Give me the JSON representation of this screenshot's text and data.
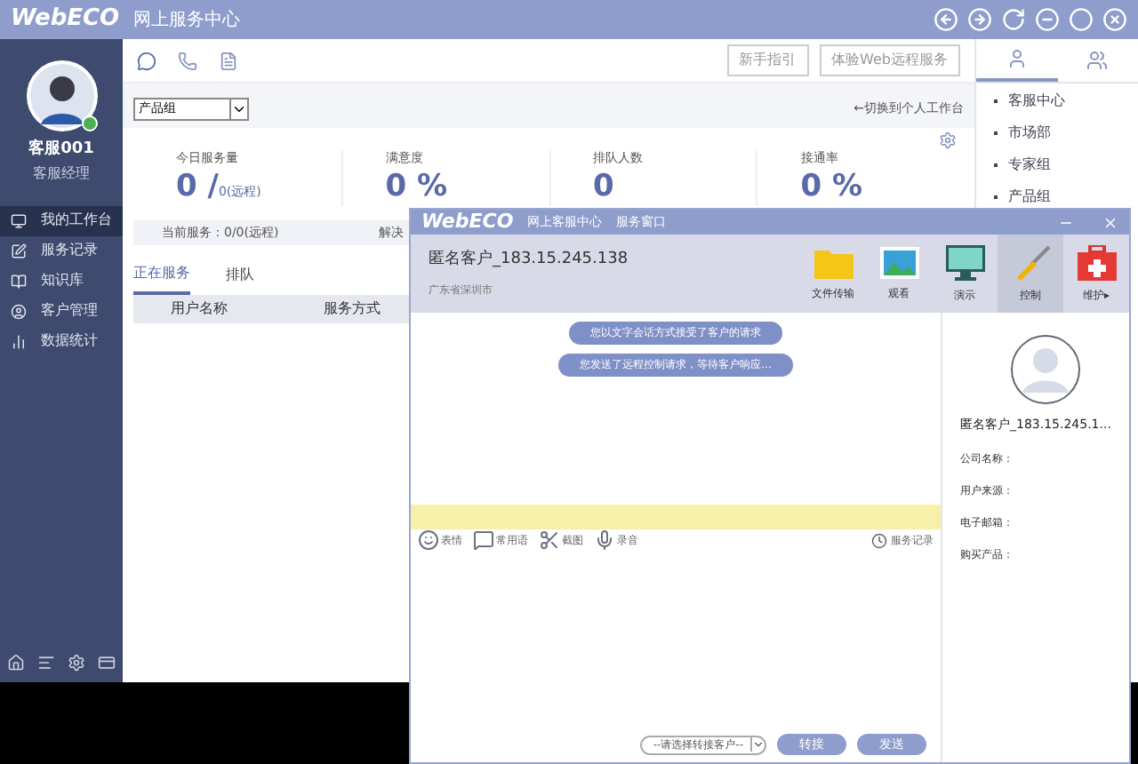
{
  "app": {
    "logo": "WebECO",
    "title": "网上服务中心"
  },
  "toolbar": {
    "buttons": [
      "新手指引",
      "体验Web远程服务"
    ]
  },
  "user": {
    "name": "客服001",
    "role": "客服经理",
    "online": true
  },
  "nav": [
    {
      "label": "我的工作台",
      "selected": true
    },
    {
      "label": "服务记录",
      "selected": false
    },
    {
      "label": "知识库",
      "selected": false
    },
    {
      "label": "客户管理",
      "selected": false
    },
    {
      "label": "数据统计",
      "selected": false
    }
  ],
  "group_select": {
    "value": "产品组"
  },
  "switch_link": "←切换到个人工作台",
  "stats": [
    {
      "label": "今日服务量",
      "value": "0 /",
      "note": "0(远程)"
    },
    {
      "label": "满意度",
      "value": "0 %"
    },
    {
      "label": "排队人数",
      "value": "0"
    },
    {
      "label": "接通率",
      "value": "0 %"
    }
  ],
  "current_service": "当前服务：0/0(远程)",
  "solve_label": "解决",
  "tabs": [
    {
      "label": "正在服务",
      "selected": true
    },
    {
      "label": "排队",
      "selected": false
    }
  ],
  "table": {
    "columns": [
      "用户名称",
      "服务方式"
    ]
  },
  "right_tabs": [
    {
      "kind": "person",
      "selected": true
    },
    {
      "kind": "people",
      "selected": false
    }
  ],
  "groups": [
    "客服中心",
    "市场部",
    "专家组",
    "产品组"
  ],
  "chat": {
    "logo": "WebECO",
    "title": "网上客服中心",
    "subtitle": "服务窗口",
    "customer": "匿名客户_183.15.245.138",
    "location": "广东省深圳市",
    "tools": [
      {
        "label": "文件传输",
        "kind": "folder",
        "selected": false
      },
      {
        "label": "观看",
        "kind": "picture",
        "selected": false
      },
      {
        "label": "演示",
        "kind": "monitor",
        "selected": false
      },
      {
        "label": "控制",
        "kind": "wrench",
        "selected": true
      },
      {
        "label": "维护▸",
        "kind": "medkit",
        "selected": false
      }
    ],
    "messages": [
      "您以文字会话方式接受了客户的请求",
      "您发送了远程控制请求，等待客户响应..."
    ],
    "input_tools": [
      {
        "label": "表情",
        "kind": "smile"
      },
      {
        "label": "常用语",
        "kind": "bubble"
      },
      {
        "label": "截图",
        "kind": "scissors"
      },
      {
        "label": "录音",
        "kind": "mic"
      }
    ],
    "history": "服务记录",
    "transfer_select": "--请选择转接客户--",
    "buttons": [
      "转接",
      "发送"
    ],
    "profile": {
      "name": "匿名客户_183.15.245.1...",
      "fields": [
        "公司名称：",
        "用户来源：",
        "电子邮箱：",
        "购买产品："
      ]
    }
  }
}
